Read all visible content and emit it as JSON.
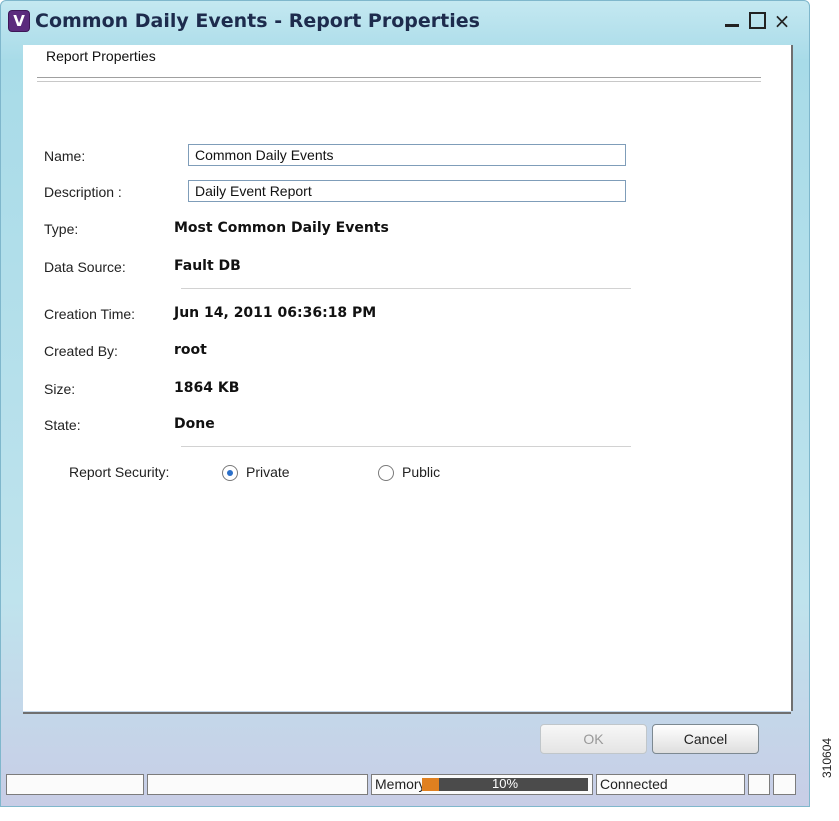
{
  "window": {
    "title": "Common Daily Events - Report Properties",
    "icon_letter": "V",
    "controls": {
      "minimize": "minimize-icon",
      "maximize": "maximize-icon",
      "close": "×"
    }
  },
  "panel": {
    "section_title": "Report Properties",
    "name_label": "Name:",
    "name_value": "Common Daily Events",
    "description_label": "Description :",
    "description_value": "Daily Event Report",
    "type_label": "Type:",
    "type_value": "Most Common Daily Events",
    "data_source_label": "Data Source:",
    "data_source_value": "Fault DB",
    "creation_time_label": "Creation Time:",
    "creation_time_value": "Jun 14, 2011 06:36:18 PM",
    "created_by_label": "Created By:",
    "created_by_value": "root",
    "size_label": "Size:",
    "size_value": "1864 KB",
    "state_label": "State:",
    "state_value": "Done",
    "security_label": "Report Security:",
    "security_options": [
      "Private",
      "Public"
    ],
    "security_selected": "Private"
  },
  "buttons": {
    "ok": "OK",
    "cancel": "Cancel"
  },
  "statusbar": {
    "memory_label": "Memory:",
    "memory_percent": 10,
    "memory_text": "10%",
    "connection": "Connected"
  },
  "figure_code": "310604",
  "colors": {
    "title_gradient": "#a8dbe8",
    "memory_fill": "#e08020",
    "memory_bg": "#4b4b4b",
    "radio_dot": "#2a6fc9"
  }
}
